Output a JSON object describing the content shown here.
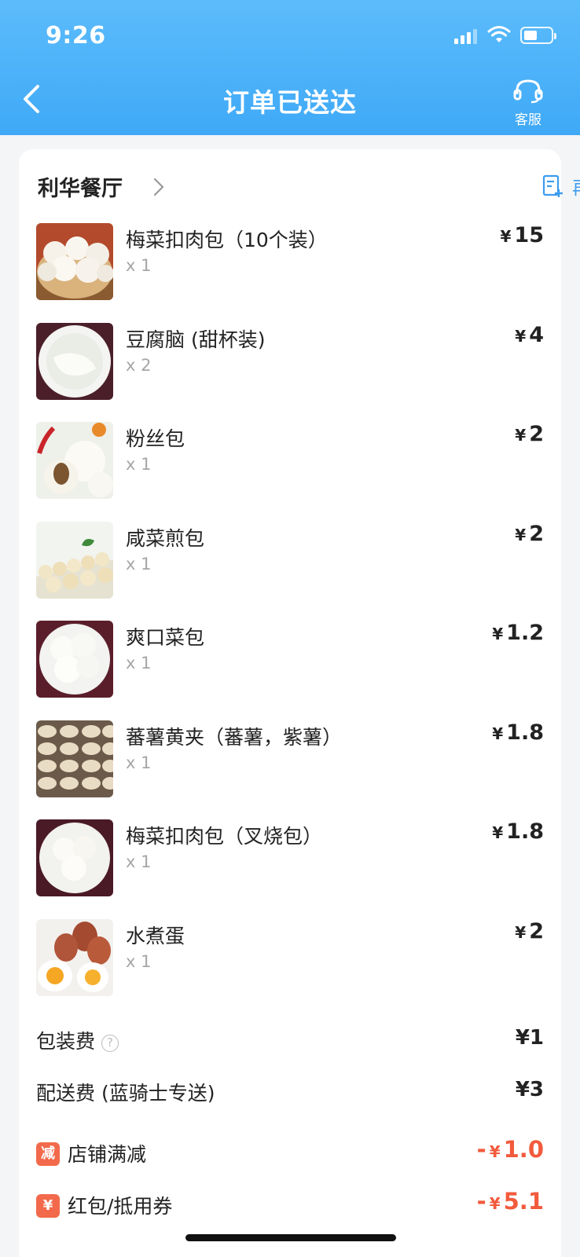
{
  "status_bar": {
    "time": "9:26"
  },
  "nav": {
    "title": "订单已送达",
    "service_label": "客服"
  },
  "shop": {
    "name": "利华餐厅",
    "reorder_label": "再来一单"
  },
  "currency_symbol": "¥",
  "items": [
    {
      "name": "梅菜扣肉包（10个装）",
      "qty": "x 1",
      "price": "15",
      "image": "steamed-buns-basket"
    },
    {
      "name": "豆腐脑 (甜杯装)",
      "qty": "x 2",
      "price": "4",
      "image": "tofu-pudding"
    },
    {
      "name": "粉丝包",
      "qty": "x 1",
      "price": "2",
      "image": "vermicelli-bun"
    },
    {
      "name": "咸菜煎包",
      "qty": "x 1",
      "price": "2",
      "image": "pan-fried-buns"
    },
    {
      "name": "爽口菜包",
      "qty": "x 1",
      "price": "1.2",
      "image": "vegetable-buns"
    },
    {
      "name": "蕃薯黄夹（蕃薯，紫薯）",
      "qty": "x 1",
      "price": "1.8",
      "image": "sweet-potato-dumplings"
    },
    {
      "name": "梅菜扣肉包（叉烧包）",
      "qty": "x 1",
      "price": "1.8",
      "image": "char-siu-buns"
    },
    {
      "name": "水煮蛋",
      "qty": "x 1",
      "price": "2",
      "image": "boiled-eggs"
    }
  ],
  "fees": [
    {
      "label": "包装费",
      "value": "¥1",
      "has_help": true
    },
    {
      "label": "配送费 (蓝骑士专送)",
      "value": "¥3",
      "has_help": false
    }
  ],
  "discounts": [
    {
      "badge": "减",
      "label": "店铺满减",
      "prefix": "-",
      "value": "1.0"
    },
    {
      "badge": "¥",
      "label": "红包/抵用券",
      "prefix": "-",
      "value": "5.1"
    }
  ],
  "colors": {
    "header": "#4ab1f8",
    "accent": "#3b9cf0",
    "discount": "#f25a3c"
  }
}
